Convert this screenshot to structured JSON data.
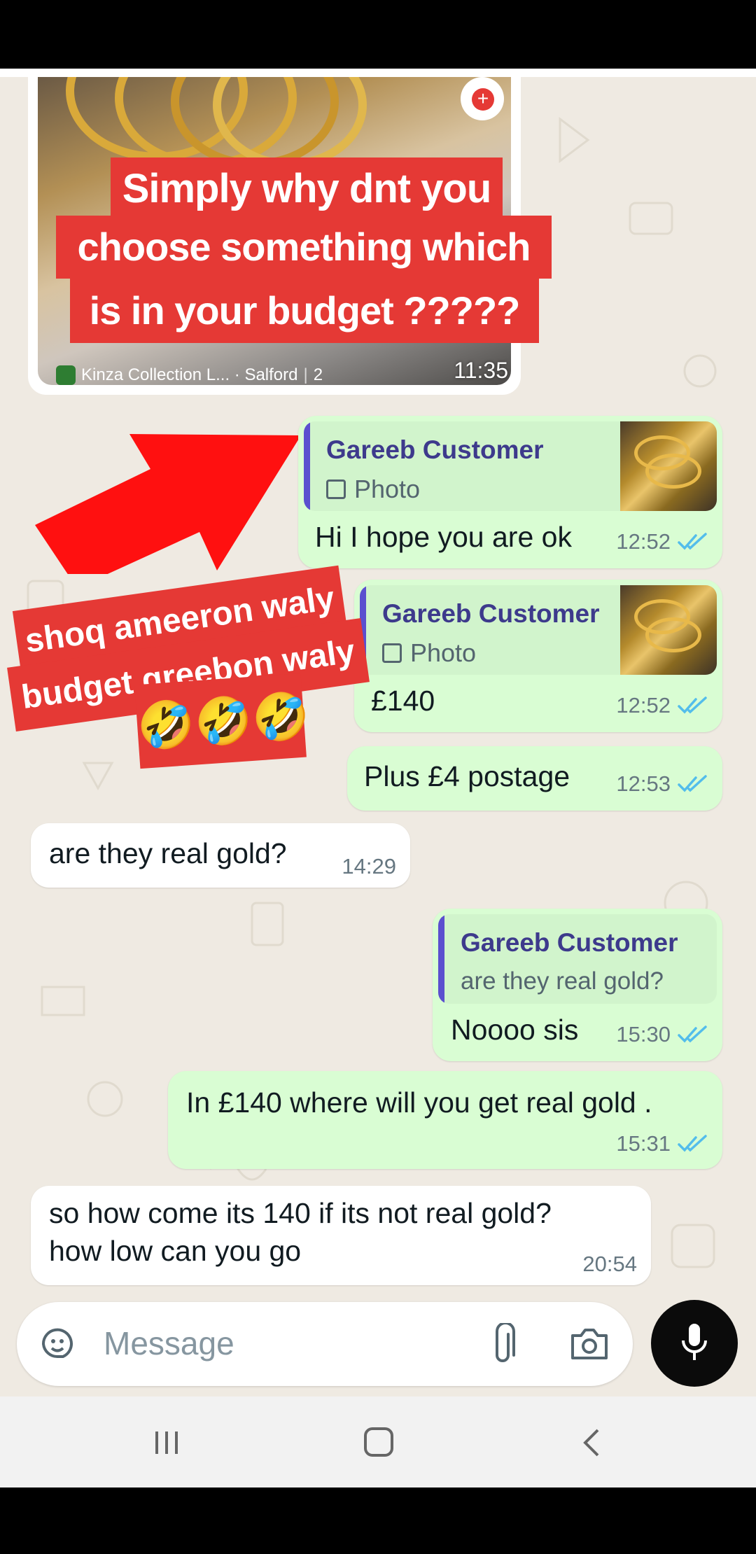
{
  "image_message": {
    "time": "11:35",
    "location": "Kinza Collection L... · Salford",
    "location_count": "2",
    "caption_lines": [
      "Simply why dnt you",
      "choose something which",
      "is in your budget ?????"
    ]
  },
  "overlay": {
    "line1": "shoq ameeron waly",
    "line2": "budget greebon waly",
    "emojis": "🤣🤣🤣"
  },
  "messages": [
    {
      "quote_name": "Gareeb Customer",
      "quote_text": "Photo",
      "text": "Hi I hope you are ok",
      "time": "12:52"
    },
    {
      "quote_name": "Gareeb Customer",
      "quote_text": "Photo",
      "text": "£140",
      "time": "12:52"
    },
    {
      "text": "Plus £4 postage",
      "time": "12:53"
    },
    {
      "text": "are they real gold?",
      "time": "14:29"
    },
    {
      "quote_name": "Gareeb Customer",
      "quote_text": "are they real gold?",
      "text": "Noooo sis",
      "time": "15:30"
    },
    {
      "text": "In £140 where will you get real gold .",
      "time": "15:31"
    },
    {
      "text_line1": "so how come its 140 if its not real gold?",
      "text_line2": "how low can you go",
      "time": "20:54"
    }
  ],
  "composer": {
    "placeholder": "Message"
  },
  "colors": {
    "incoming": "#ffffff",
    "outgoing": "#d9fdd3",
    "tick": "#53bdeb",
    "red": "#e53935"
  }
}
